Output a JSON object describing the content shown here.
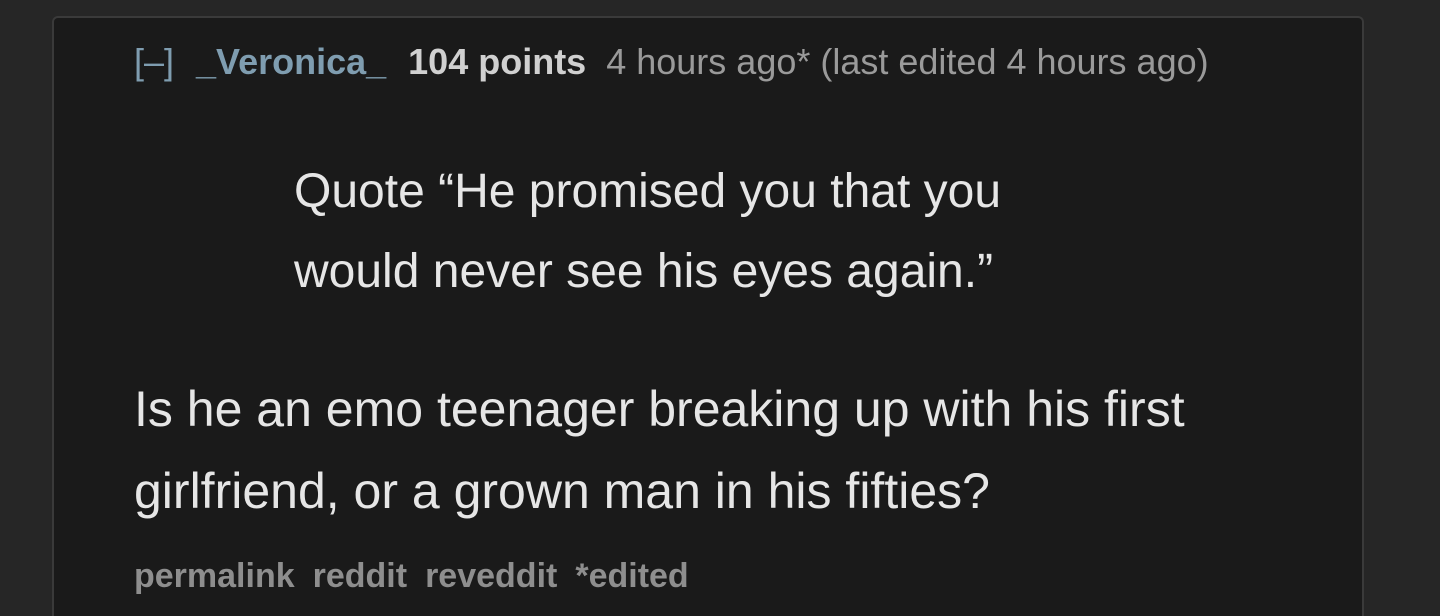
{
  "comment": {
    "collapse_label": "[–]",
    "author": "_Veronica_",
    "points": "104 points",
    "time": "4 hours ago* (last edited 4 hours ago)",
    "quote_lines": [
      "Quote “He promised you that you",
      "would never see his eyes again.”"
    ],
    "body_lines": [
      "Is he an emo teenager breaking up with his first",
      "girlfriend, or a grown man in his fifties?"
    ],
    "actions": {
      "permalink": "permalink",
      "reddit": "reddit",
      "reveddit": "reveddit",
      "edited": "*edited"
    }
  },
  "colors": {
    "page_background": "#262626",
    "comment_background": "#1a1a1a",
    "link": "#7f9db0",
    "text": "#e6e6e6",
    "muted": "#9a9a9a"
  }
}
